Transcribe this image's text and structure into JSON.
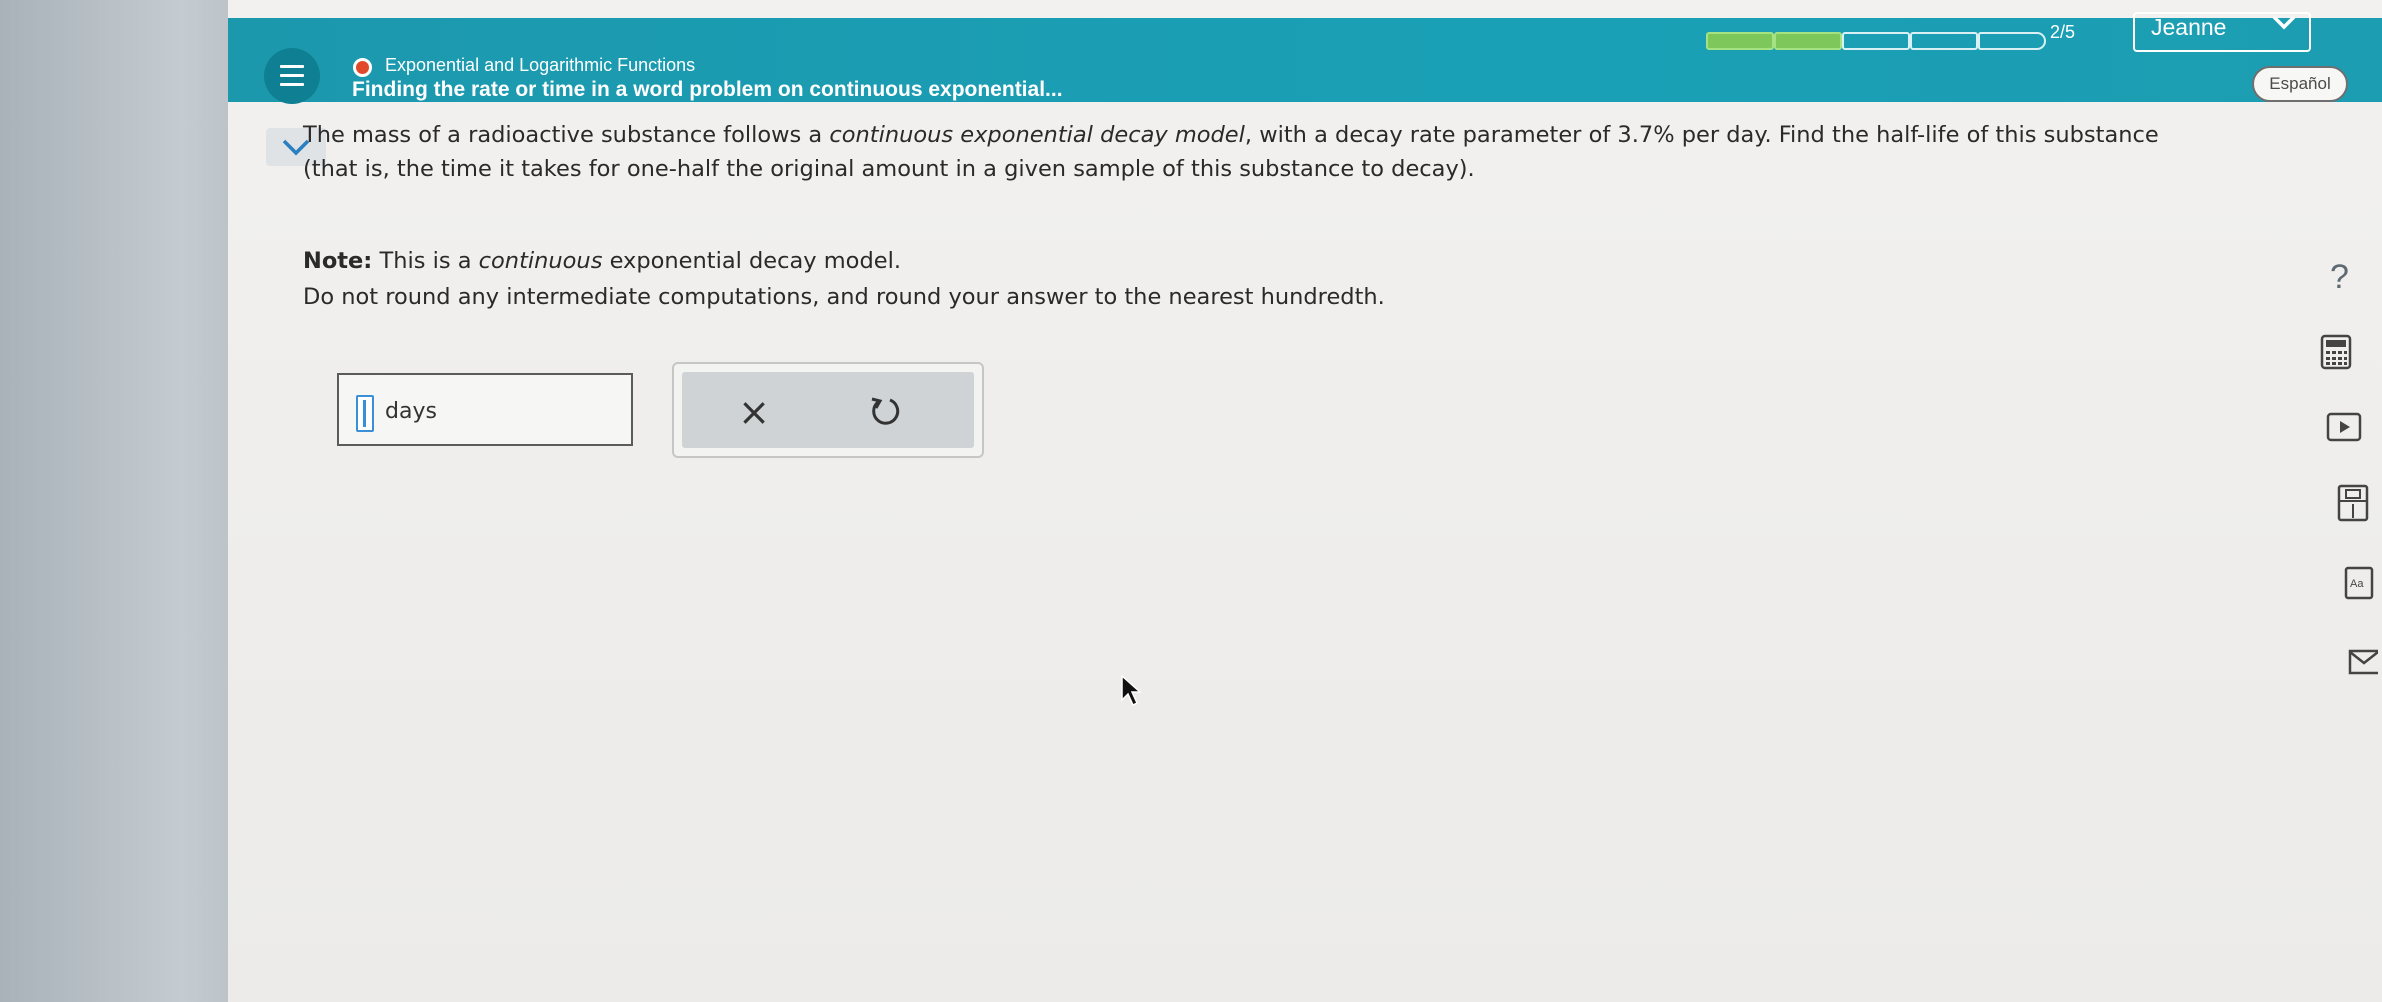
{
  "header": {
    "topic": "Exponential and Logarithmic Functions",
    "subtitle": "Finding the rate or time in a word problem on continuous exponential...",
    "progress_text": "2/5",
    "progress": {
      "completed": 2,
      "total": 5
    },
    "user_name": "Jeanne",
    "language_button": "Español"
  },
  "question": {
    "part1_a": "The mass of a radioactive substance follows a ",
    "part1_em": "continuous exponential decay model",
    "part1_b": ", with a decay rate parameter of 3.7% per day. Find the half-life of this substance (that is, the time it takes for one-half the original amount in a given sample of this substance to decay).",
    "note_label": "Note:",
    "note_a": " This is a ",
    "note_em": "continuous",
    "note_b": " exponential decay model.",
    "instruction": "Do not round any intermediate computations, and round your answer to the nearest hundredth."
  },
  "answer": {
    "value": "",
    "unit": "days"
  },
  "actions": {
    "clear_symbol": "×"
  },
  "side_tools": {
    "help_symbol": "?",
    "icons": [
      "help-icon",
      "calculator-icon",
      "video-icon",
      "textbook-icon",
      "glossary-icon",
      "message-icon"
    ]
  },
  "colors": {
    "header_bg": "#1aa0b6",
    "progress_filled": "#7ec85b",
    "topic_dot": "#e04a2a"
  }
}
